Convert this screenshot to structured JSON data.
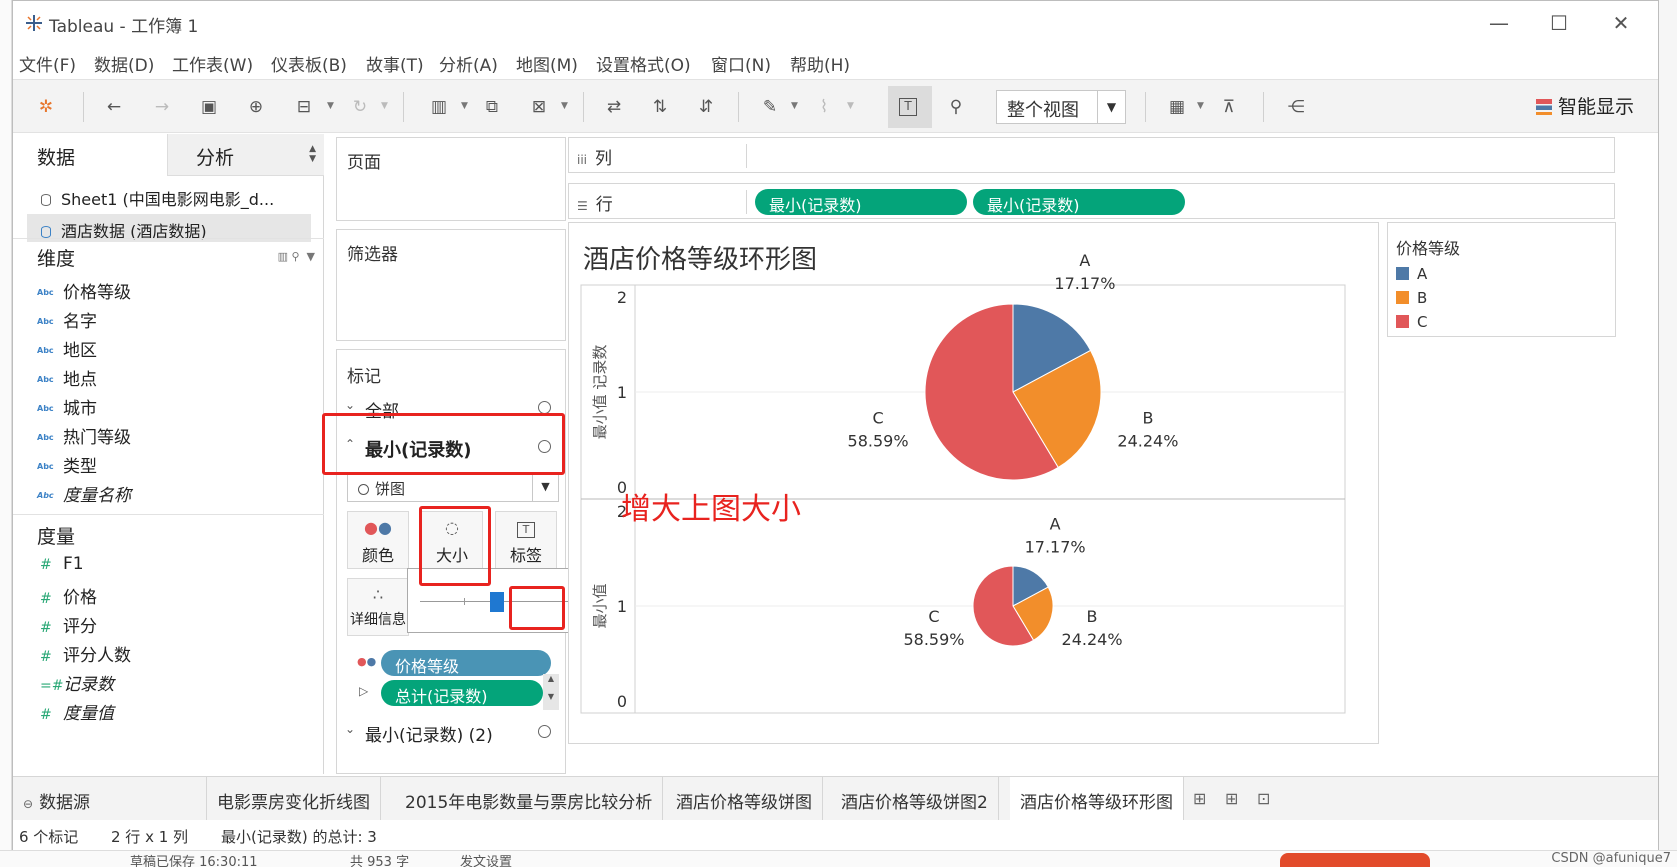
{
  "window": {
    "title": "Tableau - 工作簿 1",
    "minimize": "—",
    "maximize": "☐",
    "close": "✕"
  },
  "menu": [
    "文件(F)",
    "数据(D)",
    "工作表(W)",
    "仪表板(B)",
    "故事(T)",
    "分析(A)",
    "地图(M)",
    "设置格式(O)",
    "窗口(N)",
    "帮助(H)"
  ],
  "toolbar": {
    "view_select": "整个视图",
    "smart_show": "智能显示"
  },
  "data_pane": {
    "tab_data": "数据",
    "tab_analysis": "分析",
    "datasources": [
      "Sheet1 (中国电影网电影_d...",
      "酒店数据 (酒店数据)"
    ],
    "dimensions_title": "维度",
    "dimensions": [
      "价格等级",
      "名字",
      "地区",
      "地点",
      "城市",
      "热门等级",
      "类型",
      "度量名称"
    ],
    "measures_title": "度量",
    "measures": [
      "F1",
      "价格",
      "评分",
      "评分人数",
      "记录数",
      "度量值"
    ]
  },
  "cards": {
    "pages": "页面",
    "filters": "筛选器",
    "marks": "标记",
    "all": "全部",
    "min_records": "最小(记录数)",
    "mark_type": "饼图",
    "color_btn": "颜色",
    "size_btn": "大小",
    "label_btn": "标签",
    "detail_btn": "详细信息",
    "pill_color": "价格等级",
    "pill_angle": "总计(记录数)",
    "min_records_2": "最小(记录数) (2)",
    "size_slider": 0.45
  },
  "shelves": {
    "columns_label": "列",
    "rows_label": "行",
    "row_pills": [
      "最小(记录数)",
      "最小(记录数)"
    ]
  },
  "viz": {
    "title": "酒店价格等级环形图",
    "annotation": "增大上图大小",
    "y_axis_label": "最小值 记录数",
    "y_axis_label_2": "最小值"
  },
  "chart_data": {
    "type": "pie",
    "title": "酒店价格等级环形图",
    "ylabel": "最小值 记录数",
    "pies": [
      {
        "yticks": [
          "2",
          "1",
          "0"
        ],
        "slices": [
          {
            "name": "A",
            "value": 17.17,
            "label": "17.17%",
            "color": "#4e79a7"
          },
          {
            "name": "B",
            "value": 24.24,
            "label": "24.24%",
            "color": "#f28e2b"
          },
          {
            "name": "C",
            "value": 58.59,
            "label": "58.59%",
            "color": "#e15759"
          }
        ]
      },
      {
        "yticks": [
          "2",
          "1",
          "0"
        ],
        "slices": [
          {
            "name": "A",
            "value": 17.17,
            "label": "17.17%",
            "color": "#4e79a7"
          },
          {
            "name": "B",
            "value": 24.24,
            "label": "24.24%",
            "color": "#f28e2b"
          },
          {
            "name": "C",
            "value": 58.59,
            "label": "58.59%",
            "color": "#e15759"
          }
        ]
      }
    ]
  },
  "legend": {
    "title": "价格等级",
    "items": [
      {
        "label": "A",
        "color": "#4e79a7"
      },
      {
        "label": "B",
        "color": "#f28e2b"
      },
      {
        "label": "C",
        "color": "#e15759"
      }
    ]
  },
  "sheet_tabs": {
    "datasource": "数据源",
    "sheets": [
      "电影票房变化折线图",
      "2015年电影数量与票房比较分析",
      "酒店价格等级饼图",
      "酒店价格等级饼图2",
      "酒店价格等级环形图"
    ]
  },
  "status": {
    "marks": "6 个标记",
    "rows_cols": "2 行 x 1 列",
    "sum": "最小(记录数) 的总计: 3"
  },
  "background": {
    "saved": "草稿已保存 16:30:11",
    "words": "共 953 字",
    "publish_settings": "发文设置",
    "watermark": "CSDN @afunique7"
  }
}
